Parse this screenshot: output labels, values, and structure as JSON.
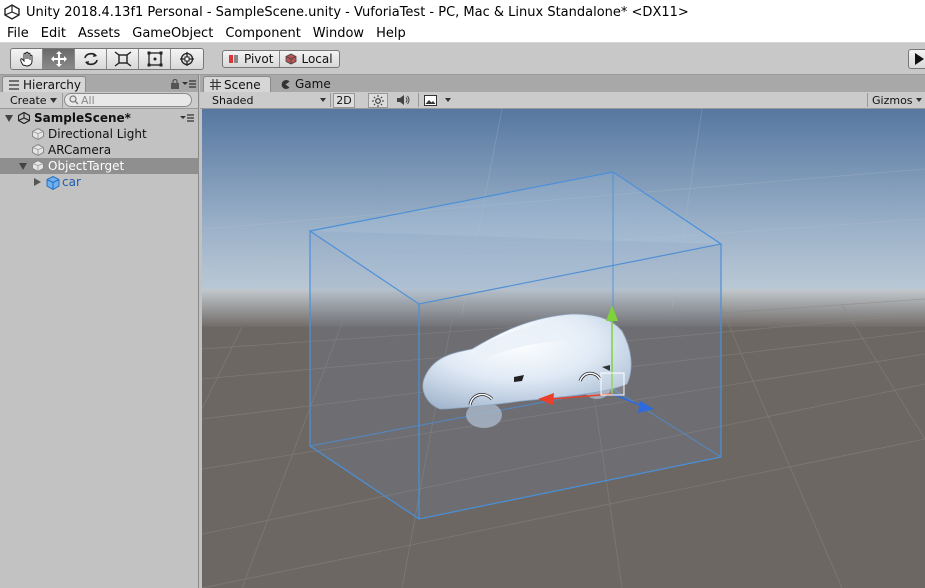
{
  "window": {
    "title": "Unity 2018.4.13f1 Personal - SampleScene.unity - VuforiaTest - PC, Mac & Linux Standalone* <DX11>"
  },
  "menu": [
    "File",
    "Edit",
    "Assets",
    "GameObject",
    "Component",
    "Window",
    "Help"
  ],
  "toolbar": {
    "tools": [
      "hand-tool",
      "move-tool",
      "rotate-tool",
      "scale-tool",
      "rect-tool",
      "transform-tool"
    ],
    "active_tool": "move-tool",
    "pivot_label": "Pivot",
    "space_label": "Local"
  },
  "hierarchy": {
    "tab_label": "Hierarchy",
    "create_label": "Create",
    "search_placeholder": "All",
    "scene_name": "SampleScene*",
    "items": [
      {
        "label": "Directional Light",
        "depth": 1
      },
      {
        "label": "ARCamera",
        "depth": 1
      },
      {
        "label": "ObjectTarget",
        "depth": 1,
        "selected": true,
        "expanded": true
      },
      {
        "label": "car",
        "depth": 2,
        "collapsed": true
      }
    ]
  },
  "scene": {
    "tabs": [
      "Scene",
      "Game"
    ],
    "active_tab": "Scene",
    "shading_mode": "Shaded",
    "mode_2d_label": "2D",
    "gizmos_label": "Gizmos"
  },
  "colors": {
    "selection_outline": "#4a90d9",
    "axis_x": "#e8402a",
    "axis_y": "#7fd23a",
    "axis_z": "#2d6ae0",
    "sky_top": "#5677a0",
    "ground": "#6d6764",
    "car_link": "#1d5db0"
  }
}
